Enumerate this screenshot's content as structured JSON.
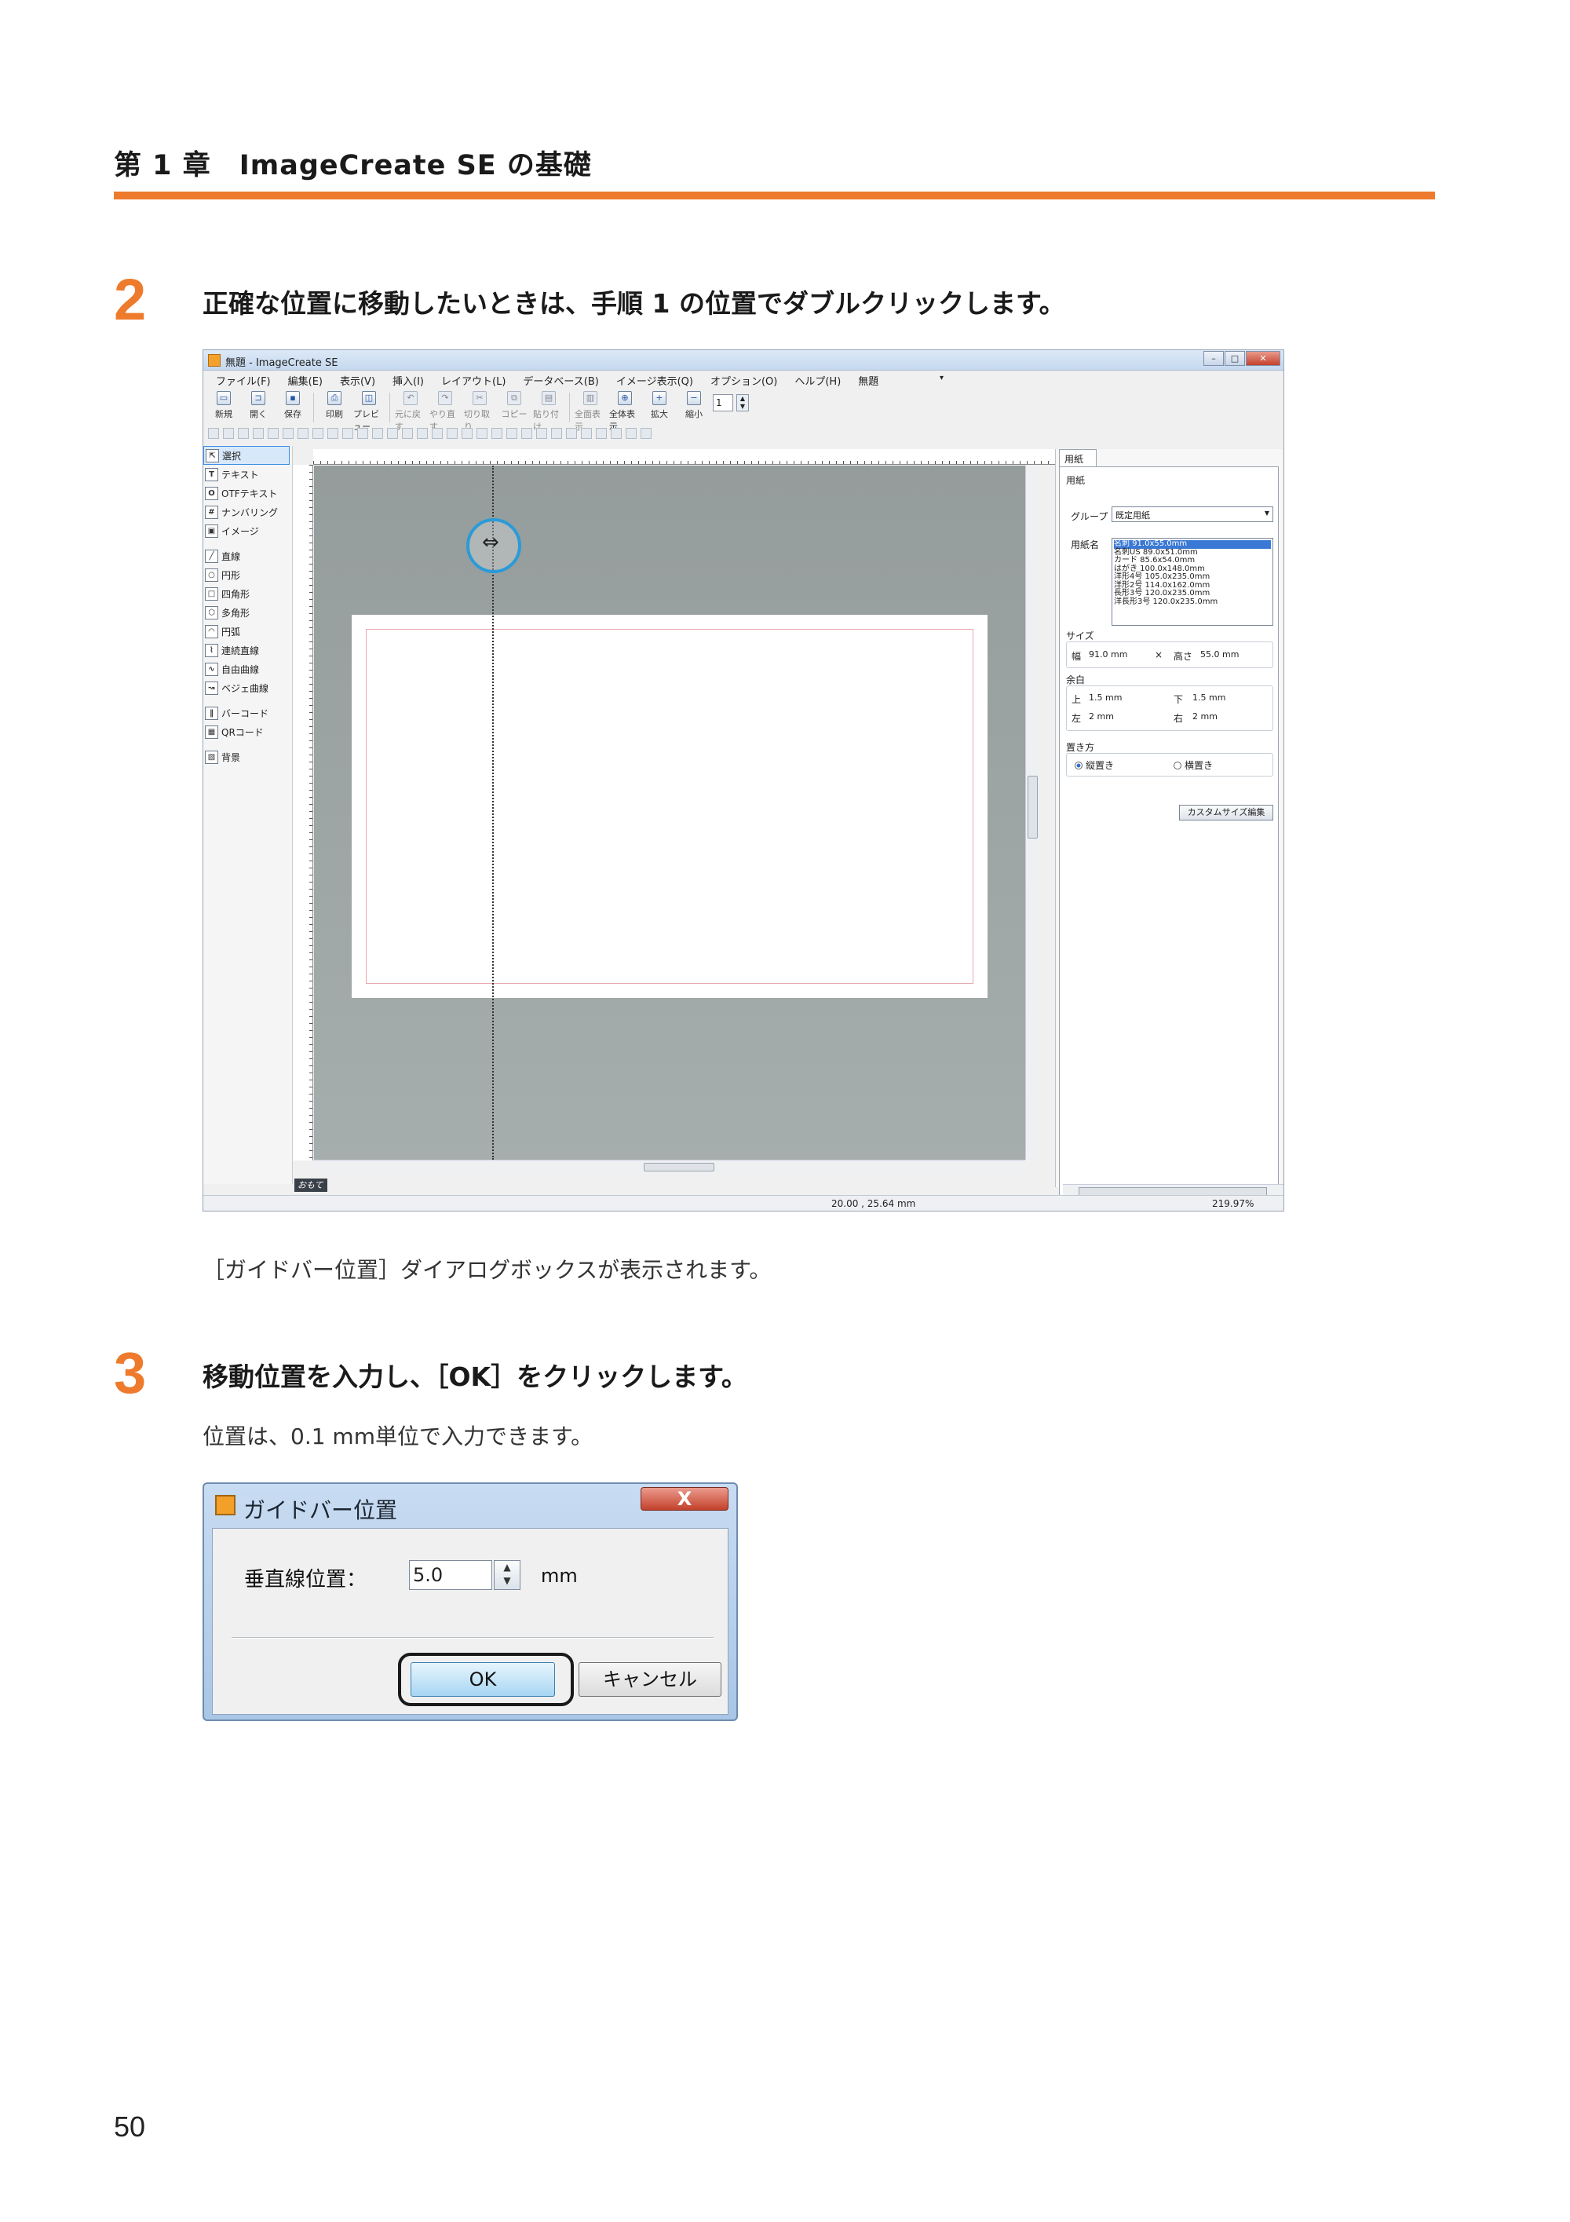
{
  "header": {
    "chapter": "第 1 章　ImageCreate SE の基礎"
  },
  "steps": [
    {
      "number": "2",
      "text": "正確な位置に移動したいときは、手順 1 の位置でダブルクリックします。",
      "note": "［ガイドバー位置］ダイアログボックスが表示されます。"
    },
    {
      "number": "3",
      "text": "移動位置を入力し、［OK］をクリックします。",
      "note": "位置は、0.1 mm単位で入力できます。"
    }
  ],
  "app": {
    "title": "無題 - ImageCreate SE",
    "window_buttons": [
      "–",
      "□",
      "✕"
    ],
    "menu": [
      "ファイル(F)",
      "編集(E)",
      "表示(V)",
      "挿入(I)",
      "レイアウト(L)",
      "データベース(B)",
      "イメージ表示(Q)",
      "オプション(O)",
      "ヘルプ(H)",
      "無題"
    ],
    "toolbar": [
      {
        "label": "新規",
        "icon": "new-file-icon",
        "glyph": "▭"
      },
      {
        "label": "開く",
        "icon": "open-folder-icon",
        "glyph": "⊐"
      },
      {
        "label": "保存",
        "icon": "save-icon",
        "glyph": "▪"
      },
      {
        "label": "印刷",
        "icon": "print-icon",
        "glyph": "⎙"
      },
      {
        "label": "プレビュー",
        "icon": "preview-icon",
        "glyph": "◫"
      },
      {
        "label": "元に戻す",
        "icon": "undo-icon",
        "glyph": "↶"
      },
      {
        "label": "やり直す",
        "icon": "redo-icon",
        "glyph": "↷"
      },
      {
        "label": "切り取り",
        "icon": "cut-icon",
        "glyph": "✂"
      },
      {
        "label": "コピー",
        "icon": "copy-icon",
        "glyph": "⧉"
      },
      {
        "label": "貼り付け",
        "icon": "paste-icon",
        "glyph": "▤"
      },
      {
        "label": "全面表示",
        "icon": "fit-page-icon",
        "glyph": "▥"
      },
      {
        "label": "全体表示",
        "icon": "zoom-all-icon",
        "glyph": "⊕"
      },
      {
        "label": "拡大",
        "icon": "zoom-in-icon",
        "glyph": "+"
      },
      {
        "label": "縮小",
        "icon": "zoom-out-icon",
        "glyph": "−"
      }
    ],
    "zoom_value": "1",
    "tools": [
      {
        "label": "選択",
        "glyph": "⇱",
        "name": "select"
      },
      {
        "label": "テキスト",
        "glyph": "T",
        "name": "text"
      },
      {
        "label": "OTFテキスト",
        "glyph": "O",
        "name": "otf-text"
      },
      {
        "label": "ナンバリング",
        "glyph": "#",
        "name": "numbering"
      },
      {
        "label": "イメージ",
        "glyph": "▣",
        "name": "image"
      },
      {
        "label": "直線",
        "glyph": "╱",
        "name": "line"
      },
      {
        "label": "円形",
        "glyph": "○",
        "name": "ellipse"
      },
      {
        "label": "四角形",
        "glyph": "□",
        "name": "rectangle"
      },
      {
        "label": "多角形",
        "glyph": "⬡",
        "name": "polygon"
      },
      {
        "label": "円弧",
        "glyph": "◠",
        "name": "arc"
      },
      {
        "label": "連続直線",
        "glyph": "⌇",
        "name": "polyline"
      },
      {
        "label": "自由曲線",
        "glyph": "∿",
        "name": "freehand"
      },
      {
        "label": "ベジェ曲線",
        "glyph": "↝",
        "name": "bezier"
      },
      {
        "label": "バーコード",
        "glyph": "‖",
        "name": "barcode"
      },
      {
        "label": "QRコード",
        "glyph": "▦",
        "name": "qrcode"
      },
      {
        "label": "背景",
        "glyph": "▧",
        "name": "background"
      }
    ],
    "mode_tab": "おもて",
    "panel": {
      "tab": "用紙",
      "section_paper": "用紙",
      "group_label": "グループ",
      "group_value": "既定用紙",
      "paper_name_label": "用紙名",
      "paper_names": [
        "名刺 91.0x55.0mm",
        "名刺US 89.0x51.0mm",
        "カード 85.6x54.0mm",
        "はがき 100.0x148.0mm",
        "洋形4号 105.0x235.0mm",
        "洋形2号 114.0x162.0mm",
        "長形3号 120.0x235.0mm",
        "洋長形3号 120.0x235.0mm"
      ],
      "size_title": "サイズ",
      "width_label": "幅",
      "width_value": "91.0 mm",
      "times": "×",
      "height_label": "高さ",
      "height_value": "55.0 mm",
      "margin_title": "余白",
      "top_label": "上",
      "top_value": "1.5 mm",
      "bottom_label": "下",
      "bottom_value": "1.5 mm",
      "left_label": "左",
      "left_value": "2 mm",
      "right_label": "右",
      "right_value": "2 mm",
      "orientation_title": "置き方",
      "portrait": "縦置き",
      "landscape": "横置き",
      "custom_button": "カスタムサイズ編集"
    },
    "status_coords": "20.00 , 25.64 mm",
    "status_zoom": "219.97%"
  },
  "dialog": {
    "title": "ガイドバー位置",
    "close": "X",
    "field_label": "垂直線位置：",
    "field_value": "5.0",
    "unit": "mm",
    "ok": "OK",
    "cancel": "キャンセル"
  },
  "page_number": "50"
}
